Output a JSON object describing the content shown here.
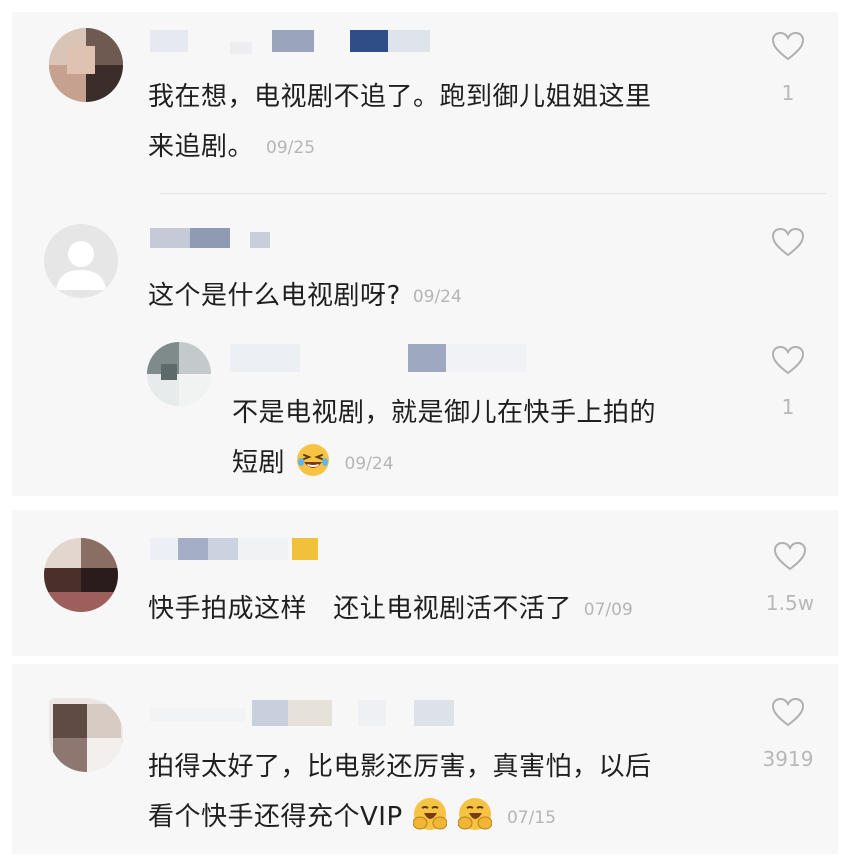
{
  "comments": [
    {
      "text_line1": "我在想，电视剧不追了。跑到御儿姐姐这里",
      "text_line2": "来追剧。",
      "date": "09/25",
      "likes": "1"
    },
    {
      "text_line1": "这个是什么电视剧呀?",
      "date": "09/24",
      "likes": "",
      "reply": {
        "text_line1": "不是电视剧，就是御儿在快手上拍的",
        "text_line2": "短剧",
        "emoji": "laughing-tears-emoji",
        "date": "09/24",
        "likes": "1"
      }
    },
    {
      "text_line1": "快手拍成这样   还让电视剧活不活了",
      "date": "07/09",
      "likes": "1.5w"
    },
    {
      "text_line1": "拍得太好了，比电影还厉害，真害怕，以后",
      "text_line2": "看个快手还得充个VIP",
      "emojis": [
        "clapping-face-emoji",
        "clapping-face-emoji"
      ],
      "date": "07/15",
      "likes": "3919"
    }
  ],
  "icons": {
    "like": "heart-outline-icon",
    "default_avatar": "user-silhouette-icon"
  },
  "colors": {
    "panel_bg": "#f7f7f7",
    "text": "#1f1f1f",
    "muted": "#b5b5b5",
    "emoji_yellow": "#f6c343"
  }
}
